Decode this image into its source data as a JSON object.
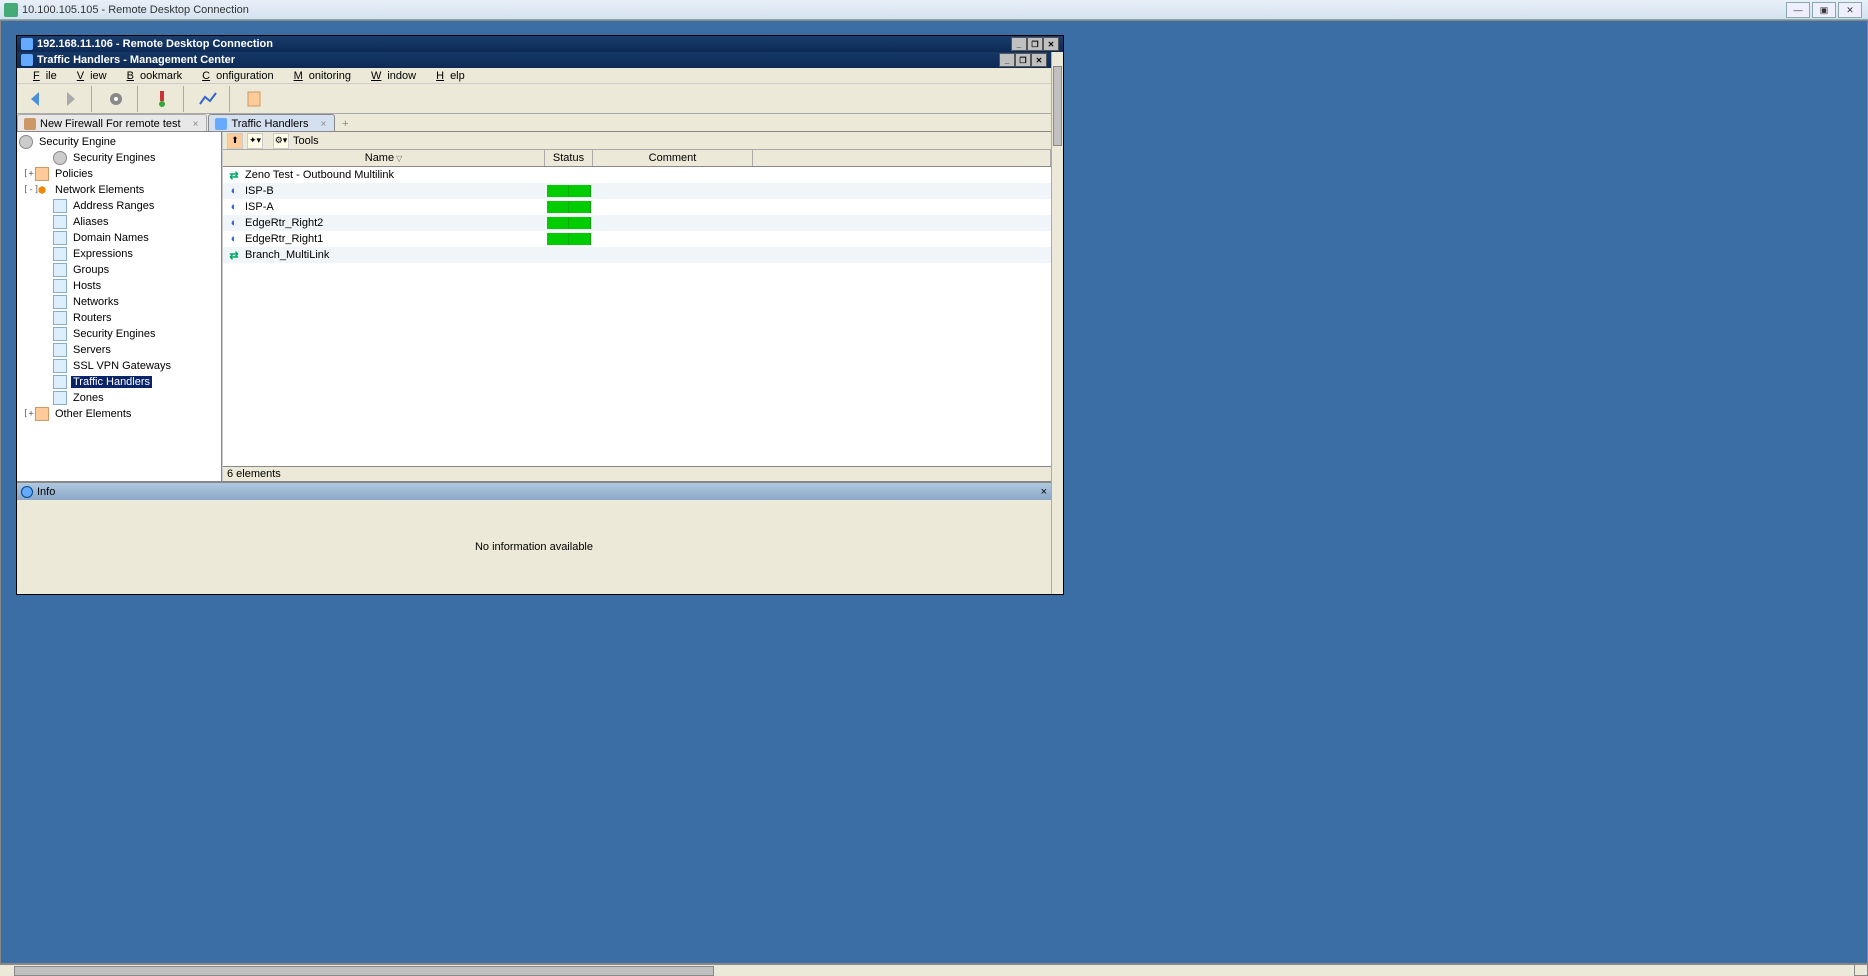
{
  "outer_rdc_title": "10.100.105.105 - Remote Desktop Connection",
  "inner_rdc_title": "192.168.11.106 - Remote Desktop Connection",
  "app_title": "Traffic Handlers - Management Center",
  "menu": {
    "file": "File",
    "view": "View",
    "bookmark": "Bookmark",
    "configuration": "Configuration",
    "monitoring": "Monitoring",
    "window": "Window",
    "help": "Help"
  },
  "tabs": [
    {
      "label": "New Firewall For remote test",
      "active": false
    },
    {
      "label": "Traffic Handlers",
      "active": true
    }
  ],
  "tree": {
    "root": "Security Engine",
    "items": [
      {
        "label": "Security Engines",
        "indent": 1,
        "icon": "gear"
      },
      {
        "label": "Policies",
        "indent": 0,
        "icon": "folder",
        "expander": "+"
      },
      {
        "label": "Network Elements",
        "indent": 0,
        "icon": "net",
        "expander": "-"
      },
      {
        "label": "Address Ranges",
        "indent": 1,
        "icon": "node"
      },
      {
        "label": "Aliases",
        "indent": 1,
        "icon": "node"
      },
      {
        "label": "Domain Names",
        "indent": 1,
        "icon": "node"
      },
      {
        "label": "Expressions",
        "indent": 1,
        "icon": "node"
      },
      {
        "label": "Groups",
        "indent": 1,
        "icon": "node"
      },
      {
        "label": "Hosts",
        "indent": 1,
        "icon": "node"
      },
      {
        "label": "Networks",
        "indent": 1,
        "icon": "node"
      },
      {
        "label": "Routers",
        "indent": 1,
        "icon": "node"
      },
      {
        "label": "Security Engines",
        "indent": 1,
        "icon": "node"
      },
      {
        "label": "Servers",
        "indent": 1,
        "icon": "node"
      },
      {
        "label": "SSL VPN Gateways",
        "indent": 1,
        "icon": "node"
      },
      {
        "label": "Traffic Handlers",
        "indent": 1,
        "icon": "node",
        "selected": true
      },
      {
        "label": "Zones",
        "indent": 1,
        "icon": "node"
      },
      {
        "label": "Other Elements",
        "indent": 0,
        "icon": "folder",
        "expander": "+"
      }
    ]
  },
  "right_toolbar": {
    "tools_label": "Tools"
  },
  "grid": {
    "columns": {
      "name": "Name",
      "status": "Status",
      "comment": "Comment"
    },
    "rows": [
      {
        "name": "Zeno Test - Outbound Multilink",
        "icon": "ml",
        "status": false
      },
      {
        "name": "ISP-B",
        "icon": "link",
        "status": true
      },
      {
        "name": "ISP-A",
        "icon": "link",
        "status": true
      },
      {
        "name": "EdgeRtr_Right2",
        "icon": "link",
        "status": true
      },
      {
        "name": "EdgeRtr_Right1",
        "icon": "link",
        "status": true
      },
      {
        "name": "Branch_MultiLink",
        "icon": "ml",
        "status": false
      }
    ],
    "footer": "6 elements"
  },
  "info": {
    "title": "Info",
    "body": "No information available"
  }
}
